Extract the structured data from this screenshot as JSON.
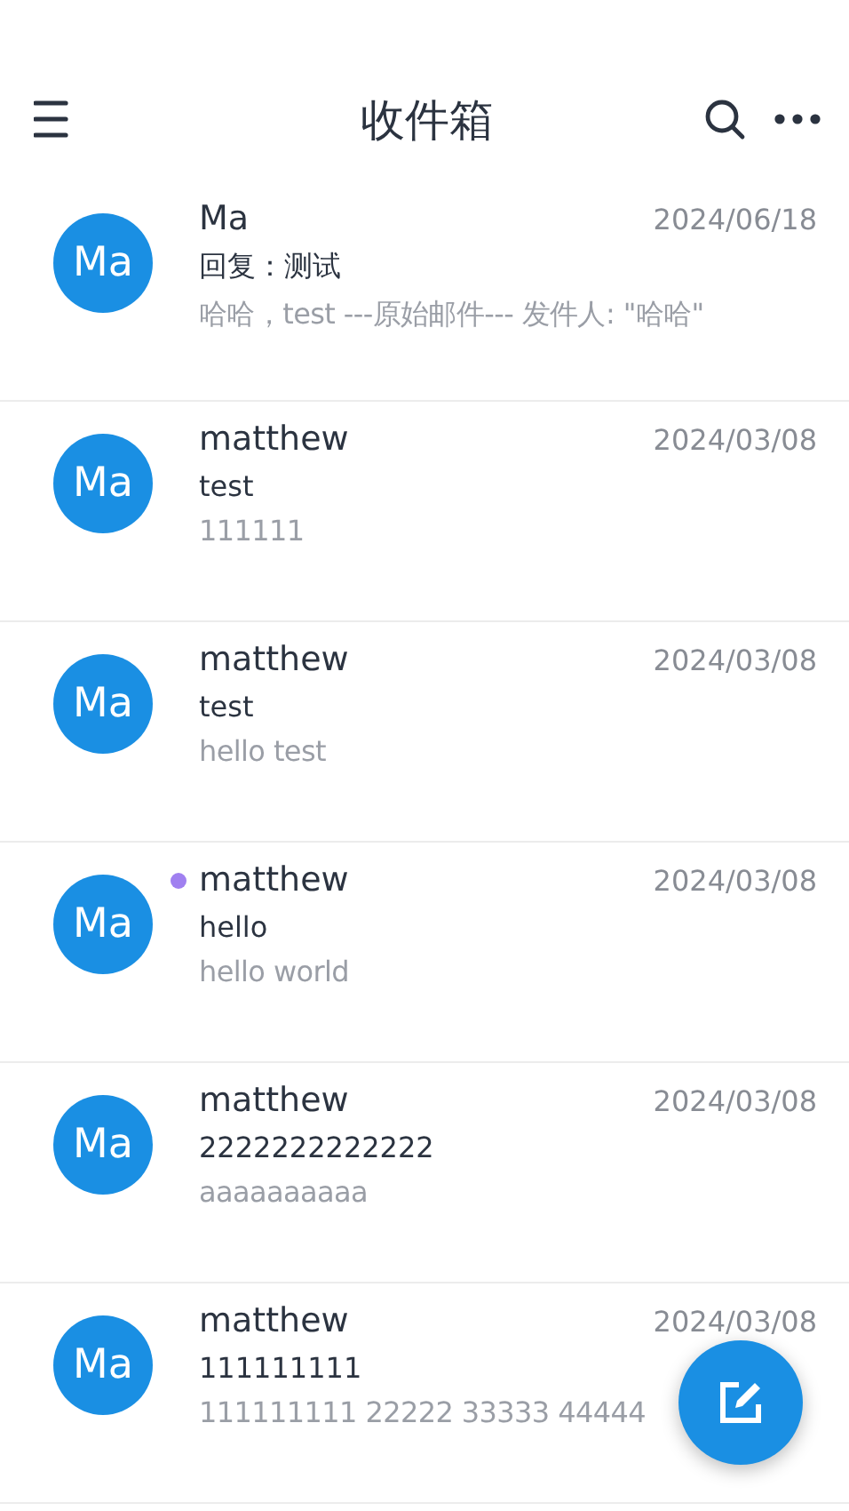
{
  "header": {
    "title": "收件箱"
  },
  "messages": [
    {
      "avatar": "Ma",
      "sender": "Ma",
      "date": "2024/06/18",
      "subject": "回复：测试",
      "preview": "哈哈，test ---原始邮件--- 发件人: \"哈哈\"",
      "unread": false
    },
    {
      "avatar": "Ma",
      "sender": "matthew",
      "date": "2024/03/08",
      "subject": "test",
      "preview": "111111",
      "unread": false
    },
    {
      "avatar": "Ma",
      "sender": "matthew",
      "date": "2024/03/08",
      "subject": "test",
      "preview": "hello test",
      "unread": false
    },
    {
      "avatar": "Ma",
      "sender": "matthew",
      "date": "2024/03/08",
      "subject": "hello",
      "preview": "hello world",
      "unread": true
    },
    {
      "avatar": "Ma",
      "sender": "matthew",
      "date": "2024/03/08",
      "subject": "2222222222222",
      "preview": "aaaaaaaaaa",
      "unread": false
    },
    {
      "avatar": "Ma",
      "sender": "matthew",
      "date": "2024/03/08",
      "subject": "111111111",
      "preview": "111111111 22222 33333 44444",
      "unread": false
    }
  ]
}
